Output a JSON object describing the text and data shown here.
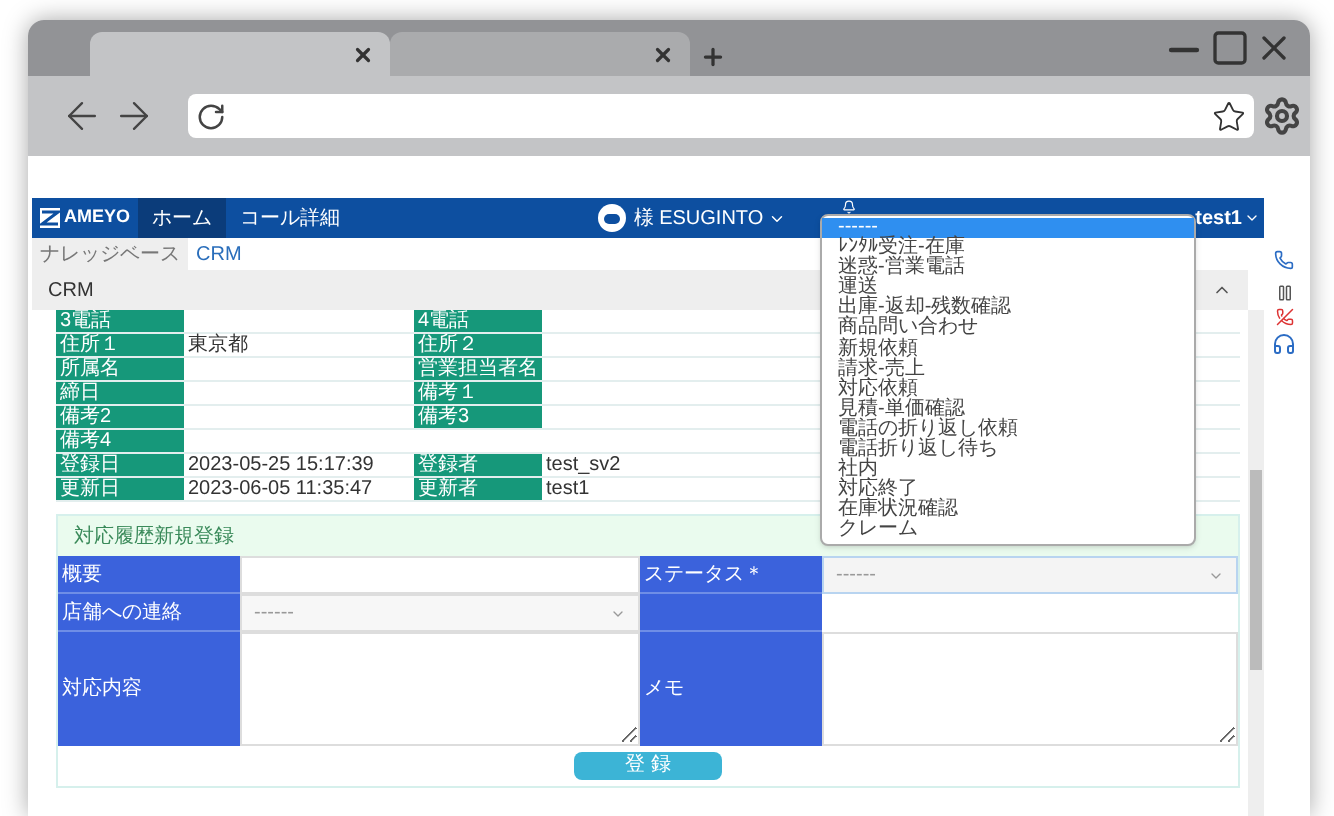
{
  "browser": {
    "tabs": [
      {
        "selected": true
      },
      {
        "selected": false
      }
    ]
  },
  "app": {
    "logo": "AMEYO",
    "nav": [
      {
        "label": "ホーム",
        "selected": true
      },
      {
        "label": "コール詳細",
        "selected": false
      }
    ],
    "user": "様 ESUGINTO",
    "account": "test1"
  },
  "breadcrumb": [
    {
      "label": "ナレッジベース",
      "selected": false
    },
    {
      "label": "CRM",
      "selected": true
    }
  ],
  "panel": {
    "title": "CRM",
    "record": [
      {
        "label": "3電話",
        "label2": "4電話"
      },
      {
        "label": "住所１",
        "value": "東京都",
        "label2": "住所２"
      },
      {
        "label": "所属名",
        "label2": "営業担当者名"
      },
      {
        "label": "締日",
        "label2": "備考１"
      },
      {
        "label": "備考2",
        "label2": "備考3"
      },
      {
        "label": "備考4"
      },
      {
        "label": "登録日",
        "value": "2023-05-25 15:17:39",
        "label2": "登録者",
        "value2": "test_sv2"
      },
      {
        "label": "更新日",
        "value": "2023-06-05 11:35:47",
        "label2": "更新者",
        "value2": "test1"
      }
    ]
  },
  "form": {
    "title": "対応履歴新規登録",
    "summary_label": "概要",
    "status_label": "ステータス＊",
    "status_value": "------",
    "contact_label": "店舗への連絡",
    "contact_value": "------",
    "content_label": "対応内容",
    "memo_label": "メモ",
    "submit": "登 録"
  },
  "status_dropdown": {
    "options": [
      {
        "label": "------",
        "selected": true
      },
      {
        "label": "ﾚﾝﾀﾙ受注-在庫",
        "selected": false
      },
      {
        "label": "迷惑-営業電話",
        "selected": false
      },
      {
        "label": "運送",
        "selected": false
      },
      {
        "label": "出庫-返却-残数確認",
        "selected": false
      },
      {
        "label": "商品問い合わせ",
        "selected": false
      },
      {
        "label": "新規依頼",
        "selected": false
      },
      {
        "label": "請求-売上",
        "selected": false
      },
      {
        "label": "対応依頼",
        "selected": false
      },
      {
        "label": "見積-単価確認",
        "selected": false
      },
      {
        "label": "電話の折り返し依頼",
        "selected": false
      },
      {
        "label": "電話折り返し待ち",
        "selected": false
      },
      {
        "label": "社内",
        "selected": false
      },
      {
        "label": "対応終了",
        "selected": false
      },
      {
        "label": "在庫状況確認",
        "selected": false
      },
      {
        "label": "クレーム",
        "selected": false
      }
    ]
  }
}
